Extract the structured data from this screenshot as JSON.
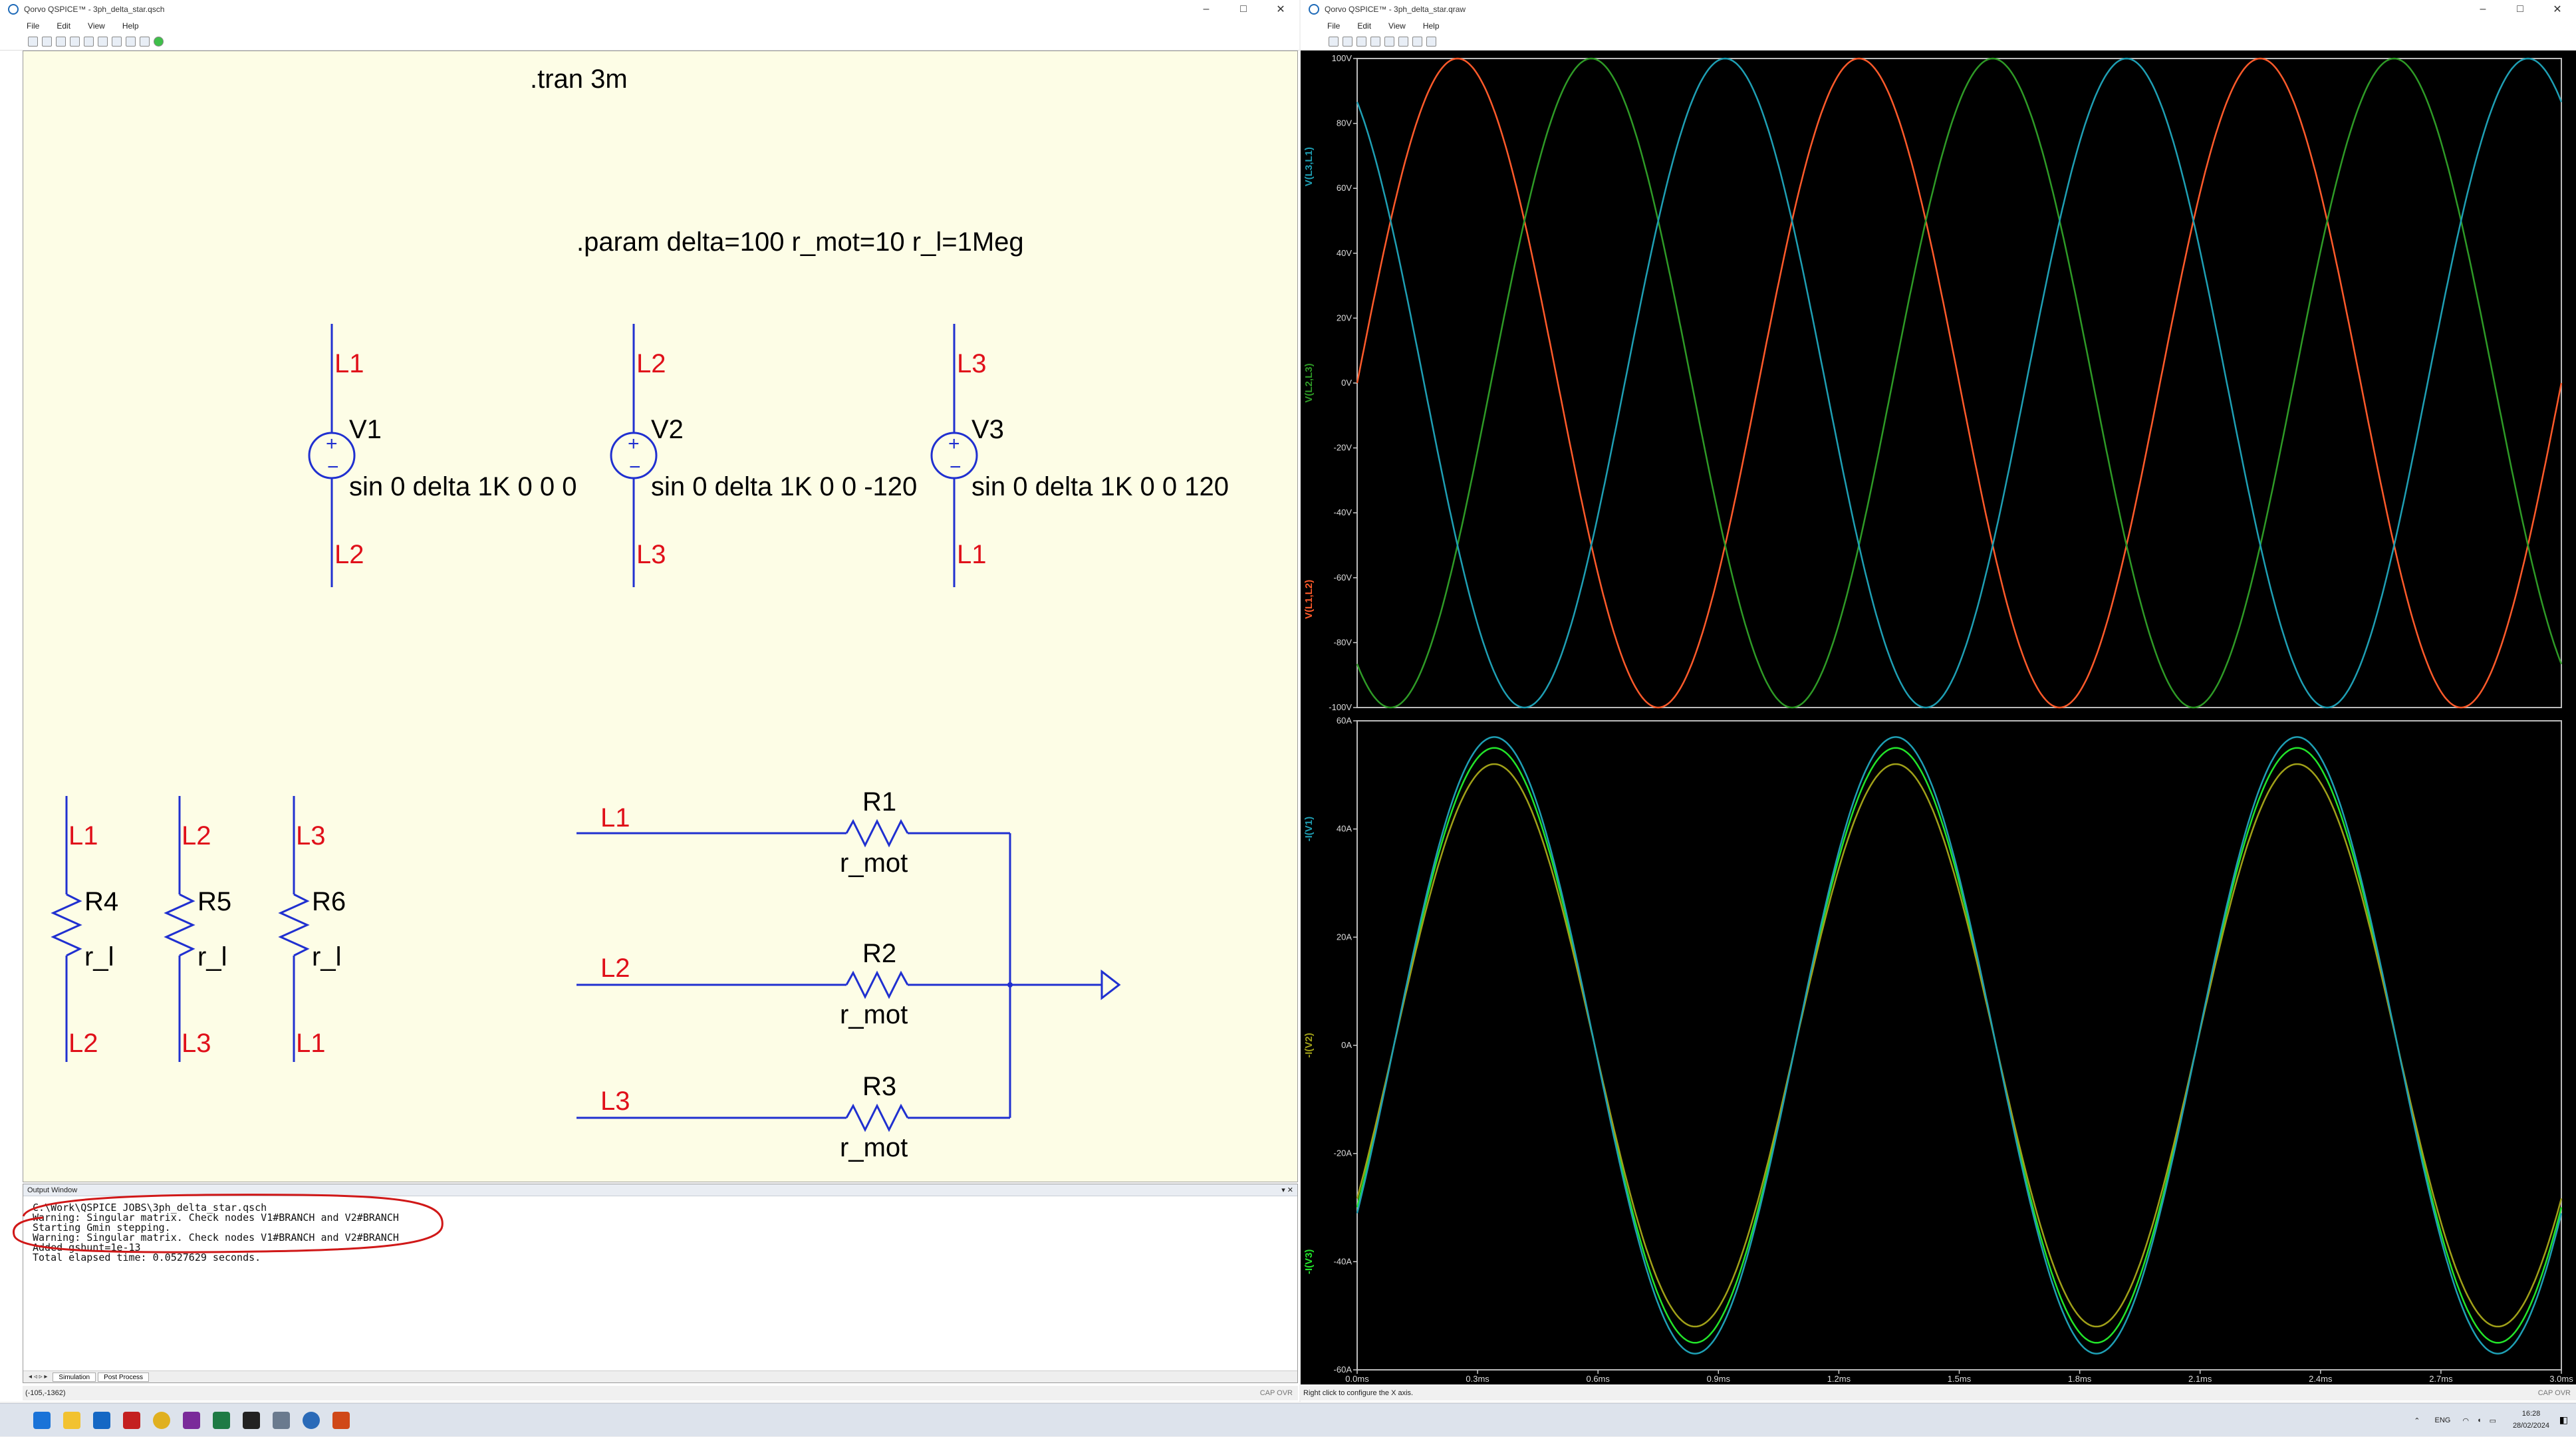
{
  "left_window": {
    "title": "Qorvo QSPICE™ - 3ph_delta_star.qsch",
    "menu": [
      "File",
      "Edit",
      "View",
      "Help"
    ]
  },
  "right_window": {
    "title": "Qorvo QSPICE™ - 3ph_delta_star.qraw",
    "menu": [
      "File",
      "Edit",
      "View",
      "Help"
    ]
  },
  "window_controls": {
    "minimize": "–",
    "maximize": "□",
    "close": "✕"
  },
  "schematic": {
    "directive_tran": ".tran 3m",
    "directive_param": ".param delta=100 r_mot=10 r_l=1Meg",
    "sources": [
      {
        "name": "V1",
        "value": "sin 0 delta 1K 0 0 0",
        "top": "L1",
        "bottom": "L2"
      },
      {
        "name": "V2",
        "value": "sin 0 delta 1K 0 0 -120",
        "top": "L2",
        "bottom": "L3"
      },
      {
        "name": "V3",
        "value": "sin 0 delta 1K 0 0 120",
        "top": "L3",
        "bottom": "L1"
      }
    ],
    "load_resistors": [
      {
        "name": "R4",
        "value": "r_l",
        "top": "L1",
        "bottom": "L2"
      },
      {
        "name": "R5",
        "value": "r_l",
        "top": "L2",
        "bottom": "L3"
      },
      {
        "name": "R6",
        "value": "r_l",
        "top": "L3",
        "bottom": "L1"
      }
    ],
    "star_resistors": [
      {
        "name": "R1",
        "value": "r_mot",
        "node": "L1"
      },
      {
        "name": "R2",
        "value": "r_mot",
        "node": "L2"
      },
      {
        "name": "R3",
        "value": "r_mot",
        "node": "L3"
      }
    ]
  },
  "output_window": {
    "title": "Output Window",
    "lines": [
      "C:\\Work\\QSPICE JOBS\\3ph_delta_star.qsch",
      "Warning: Singular matrix. Check nodes V1#BRANCH and V2#BRANCH",
      "Starting Gmin stepping.",
      "Warning: Singular matrix. Check nodes V1#BRANCH and V2#BRANCH",
      "Added gshunt=1e-13",
      "",
      "Total elapsed time: 0.0527629 seconds."
    ],
    "tabs": [
      "Simulation",
      "Post Process"
    ]
  },
  "status": {
    "left_coords": "(-105,-1362)",
    "left_mode": "CAP OVR",
    "right_hint": "Right click to configure the X axis.",
    "right_mode": "CAP OVR"
  },
  "chart_data": [
    {
      "type": "line",
      "title": "",
      "xlabel": "",
      "ylabel": "",
      "xlim": [
        0,
        3
      ],
      "ylim": [
        -100,
        100
      ],
      "yticks": [
        "100V",
        "80V",
        "60V",
        "40V",
        "20V",
        "0V",
        "-20V",
        "-40V",
        "-60V",
        "-80V",
        "-100V"
      ],
      "grid": false,
      "series": [
        {
          "name": "V(L1,L2)",
          "color": "#ff5a2a",
          "amplitude": 100,
          "freq_khz": 1,
          "phase_deg": 0
        },
        {
          "name": "V(L2,L3)",
          "color": "#2e9a26",
          "amplitude": 100,
          "freq_khz": 1,
          "phase_deg": -120
        },
        {
          "name": "V(L3,L1)",
          "color": "#1e9fb4",
          "amplitude": 100,
          "freq_khz": 1,
          "phase_deg": 120
        }
      ]
    },
    {
      "type": "line",
      "title": "",
      "xlabel": "",
      "ylabel": "",
      "xlim": [
        0,
        3
      ],
      "ylim": [
        -60,
        60
      ],
      "yticks": [
        "60A",
        "40A",
        "20A",
        "0A",
        "-20A",
        "-40A",
        "-60A"
      ],
      "xticks": [
        "0.0ms",
        "0.3ms",
        "0.6ms",
        "0.9ms",
        "1.2ms",
        "1.5ms",
        "1.8ms",
        "2.1ms",
        "2.4ms",
        "2.7ms",
        "3.0ms"
      ],
      "grid": false,
      "series": [
        {
          "name": "-I(V3)",
          "color": "#22e42a",
          "amplitude": 55,
          "freq_khz": 1,
          "phase_deg": -33
        },
        {
          "name": "-I(V2)",
          "color": "#a0a018",
          "amplitude": 52,
          "freq_khz": 1,
          "phase_deg": -33
        },
        {
          "name": "-I(V1)",
          "color": "#1e9fb4",
          "amplitude": 57,
          "freq_khz": 1,
          "phase_deg": -33
        }
      ]
    }
  ],
  "taskbar": {
    "language": "ENG",
    "time": "16:28",
    "date": "28/02/2024"
  }
}
